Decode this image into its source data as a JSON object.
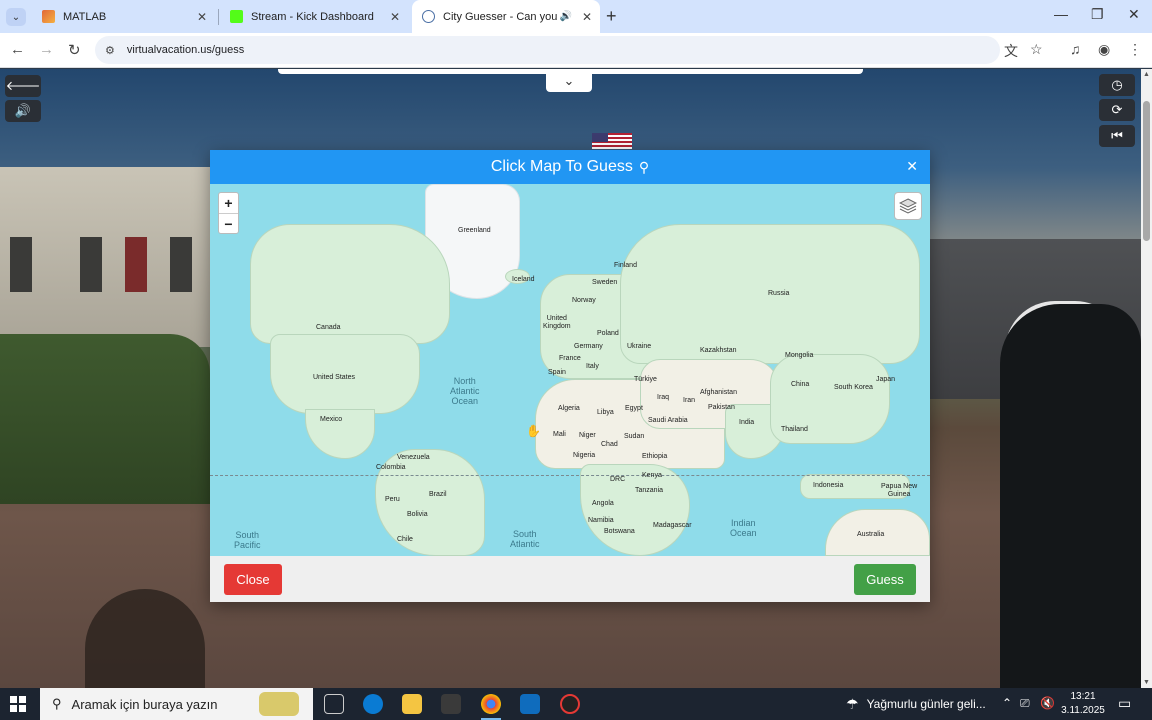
{
  "browser": {
    "tabs": [
      {
        "title": "MATLAB",
        "active": false
      },
      {
        "title": "Stream - Kick Dashboard",
        "active": false
      },
      {
        "title": "City Guesser - Can you gue",
        "active": true
      }
    ],
    "url": "virtualvacation.us/guess"
  },
  "modal": {
    "title": "Click Map To Guess",
    "close_label": "Close",
    "guess_label": "Guess"
  },
  "map": {
    "labels": {
      "greenland": "Greenland",
      "iceland": "Iceland",
      "finland": "Finland",
      "sweden": "Sweden",
      "norway": "Norway",
      "russia": "Russia",
      "uk": "United\nKingdom",
      "poland": "Poland",
      "germany": "Germany",
      "ukraine": "Ukraine",
      "france": "France",
      "kazakhstan": "Kazakhstan",
      "mongolia": "Mongolia",
      "canada": "Canada",
      "spain": "Spain",
      "italy": "Italy",
      "turkiye": "Türkiye",
      "usa": "United States",
      "china": "China",
      "south_korea": "South Korea",
      "japan": "Japan",
      "iraq": "Iraq",
      "iran": "Iran",
      "afghanistan": "Afghanistan",
      "algeria": "Algeria",
      "libya": "Libya",
      "egypt": "Egypt",
      "pakistan": "Pakistan",
      "mexico": "Mexico",
      "saudi": "Saudi Arabia",
      "india": "India",
      "mali": "Mali",
      "niger": "Niger",
      "sudan": "Sudan",
      "thailand": "Thailand",
      "chad": "Chad",
      "venezuela": "Venezuela",
      "nigeria": "Nigeria",
      "ethiopia": "Ethiopia",
      "colombia": "Colombia",
      "kenya": "Kenya",
      "drc": "DRC",
      "indonesia": "Indonesia",
      "peru": "Peru",
      "brazil": "Brazil",
      "tanzania": "Tanzania",
      "png": "Papua New\nGuinea",
      "angola": "Angola",
      "bolivia": "Bolivia",
      "namibia": "Namibia",
      "madagascar": "Madagascar",
      "botswana": "Botswana",
      "chile": "Chile",
      "australia": "Australia"
    },
    "oceans": {
      "north_atlantic": "North\nAtlantic\nOcean",
      "south_pacific": "South\nPacific",
      "south_atlantic": "South\nAtlantic",
      "indian": "Indian\nOcean"
    },
    "zoom_in": "+",
    "zoom_out": "−"
  },
  "taskbar": {
    "search_placeholder": "Aramak için buraya yazın",
    "weather": "Yağmurlu günler geli...",
    "time": "13:21",
    "date": "3.11.2025"
  },
  "colors": {
    "modal_header": "#2196f3",
    "close_button": "#e53935",
    "guess_button": "#43a047",
    "water": "#8fdcea",
    "land": "#d8efd9"
  }
}
